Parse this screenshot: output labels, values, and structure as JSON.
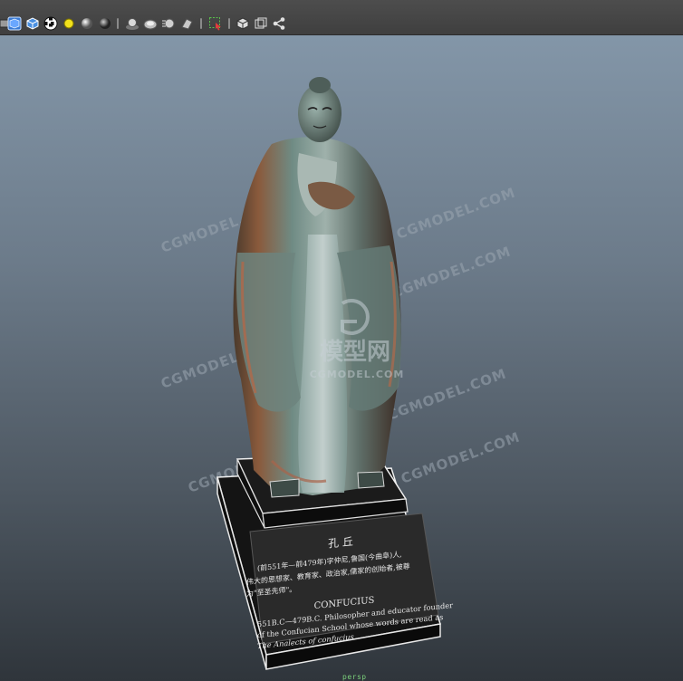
{
  "toolbar": {
    "icons": [
      "select-camera-icon",
      "smooth-shade-cube-icon",
      "wireframe-cube-icon",
      "texture-checker-icon",
      "use-default-light-icon",
      "shaded-sphere-icon",
      "dark-sphere-icon",
      "shadows-icon",
      "ambient-occlusion-icon",
      "motion-blur-icon",
      "anti-alias-icon",
      "isolate-select-icon",
      "xray-icon",
      "backface-culling-icon",
      "sharing-icon"
    ],
    "accent_yellow": "#f2e11b"
  },
  "watermarks": {
    "site": "CGMODEL.COM",
    "logo_text": "模型网"
  },
  "plaque": {
    "title_cn": "孔 丘",
    "line_cn_1": "(前551年—前479年)字仲尼,鲁国(今曲阜)人,",
    "line_cn_2": "伟大的思想家、教育家、政治家,儒家的创始者,被尊",
    "line_cn_3": "为\"至圣先师\"。",
    "title_en": "CONFUCIUS",
    "line_en_1": "551B.C—479B.C. Philosopher and educator founder",
    "line_en_2": "of the Confucian School whose words are read as",
    "line_en_3": "The Analects of confucius"
  },
  "status": {
    "frame_label": "persp"
  }
}
